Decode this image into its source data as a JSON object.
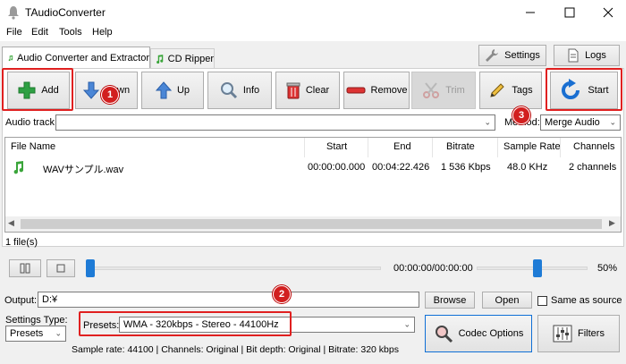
{
  "window": {
    "title": "TAudioConverter"
  },
  "menu": [
    "File",
    "Edit",
    "Tools",
    "Help"
  ],
  "tabs": {
    "converter": "Audio Converter and Extractor",
    "ripper": "CD Ripper"
  },
  "top_buttons": {
    "settings": "Settings",
    "logs": "Logs"
  },
  "toolbar": {
    "add": "Add",
    "down": "Down",
    "up": "Up",
    "info": "Info",
    "clear": "Clear",
    "remove": "Remove",
    "trim": "Trim",
    "tags": "Tags",
    "start": "Start"
  },
  "audio_track": {
    "label": "Audio track:",
    "value": ""
  },
  "method": {
    "label": "Method:",
    "value": "Merge Audio"
  },
  "table": {
    "columns": [
      "File Name",
      "Start",
      "End",
      "Bitrate",
      "Sample Rate",
      "Channels"
    ],
    "rows": [
      {
        "name": "WAVサンプル.wav",
        "start": "00:00:00.000",
        "end": "00:04:22.426",
        "bitrate": "1 536 Kbps",
        "sample_rate": "48.0 KHz",
        "channels": "2 channels"
      }
    ]
  },
  "file_count": "1 file(s)",
  "playback": {
    "time": "00:00:00/00:00:00",
    "volume": "50%",
    "position": 0,
    "volume_level": 0.5
  },
  "output": {
    "label": "Output:",
    "value": "D:¥",
    "browse": "Browse",
    "open": "Open",
    "same_as_source": "Same as source"
  },
  "settings_type": {
    "label": "Settings Type:",
    "value": "Presets"
  },
  "presets": {
    "label": "Presets:",
    "value": "WMA - 320kbps - Stereo - 44100Hz"
  },
  "codec_options": "Codec Options",
  "filters": "Filters",
  "status": "Sample rate: 44100 | Channels: Original | Bit depth: Original | Bitrate: 320 kbps",
  "annotations": {
    "one": "1",
    "two": "2",
    "three": "3"
  },
  "colors": {
    "highlight_red": "#e02020",
    "accent_blue": "#1a5fb4",
    "slider_blue": "#1e7bd6"
  }
}
